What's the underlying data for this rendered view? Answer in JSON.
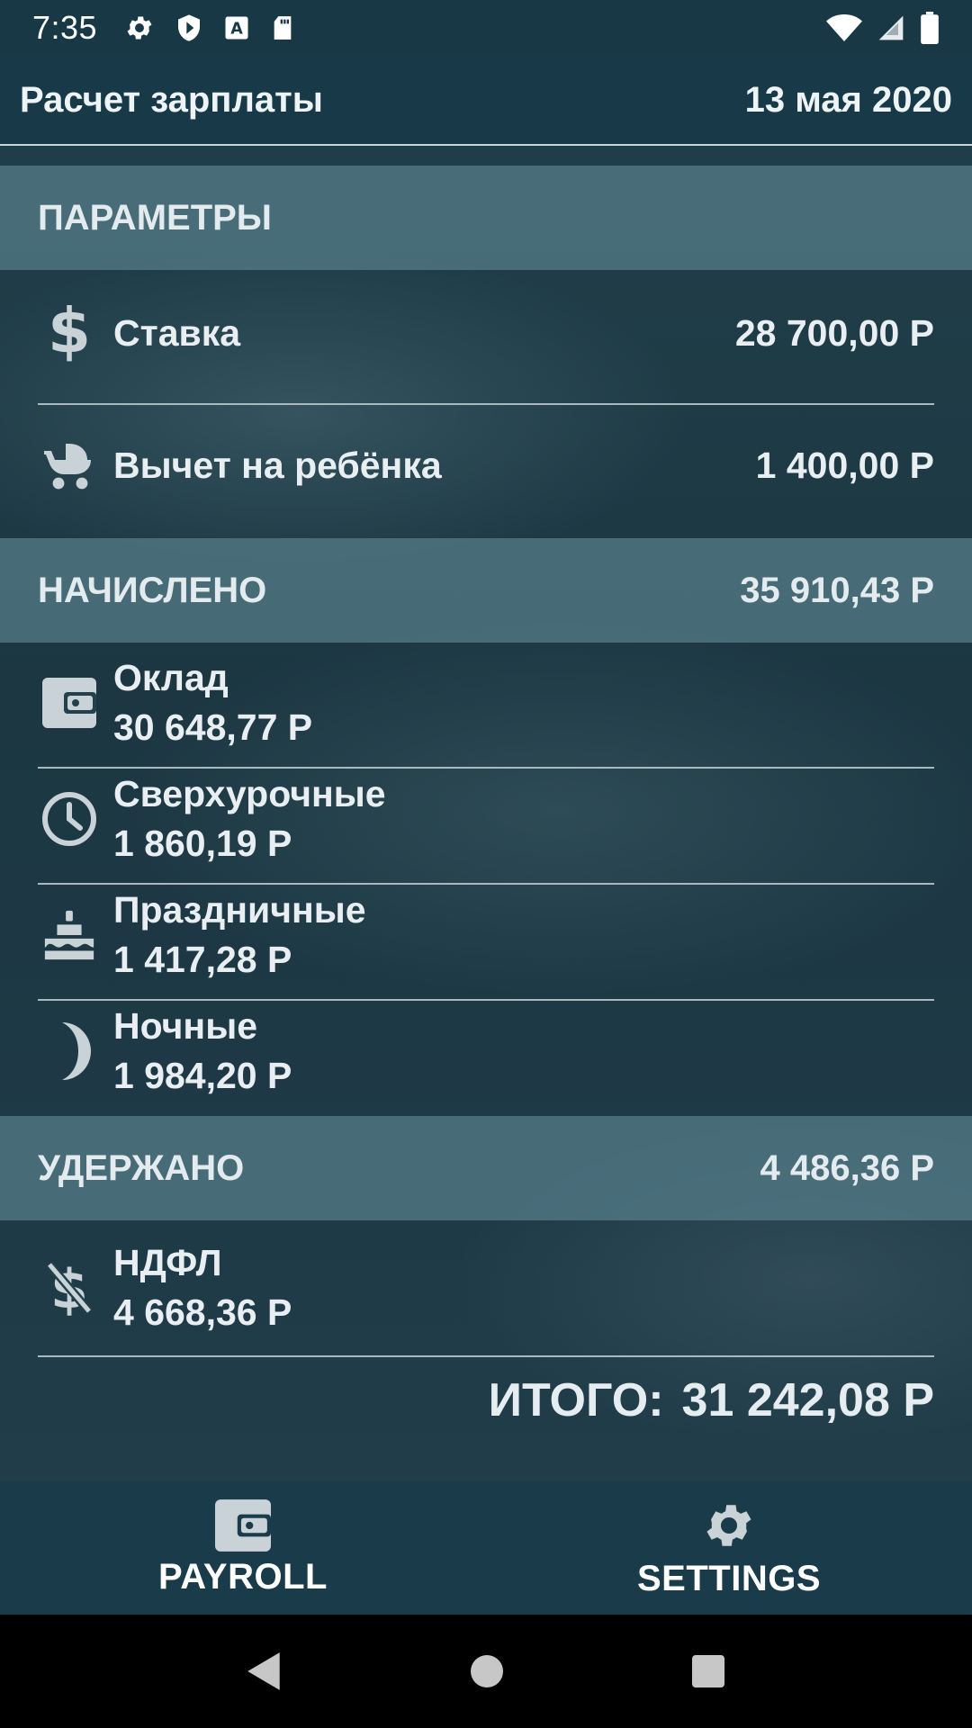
{
  "status_bar": {
    "time": "7:35",
    "icons": [
      "gear-icon",
      "shield-icon",
      "a-icon",
      "sd-card-icon"
    ],
    "right_icons": [
      "wifi-icon",
      "signal-icon",
      "battery-icon"
    ]
  },
  "app_bar": {
    "title": "Расчет зарплаты",
    "date": "13 мая 2020"
  },
  "parameters": {
    "header": "ПАРАМЕТРЫ",
    "items": [
      {
        "icon": "dollar-icon",
        "label": "Ставка",
        "value": "28 700,00 Р"
      },
      {
        "icon": "stroller-icon",
        "label": "Вычет на ребёнка",
        "value": "1 400,00 Р"
      }
    ]
  },
  "accrued": {
    "header": "НАЧИСЛЕНО",
    "total": "35 910,43 Р",
    "items": [
      {
        "icon": "wallet-icon",
        "label": "Оклад",
        "value": "30 648,77 Р"
      },
      {
        "icon": "clock-icon",
        "label": "Сверхурочные",
        "value": "1 860,19 Р"
      },
      {
        "icon": "cake-icon",
        "label": "Праздничные",
        "value": "1 417,28 Р"
      },
      {
        "icon": "moon-icon",
        "label": "Ночные",
        "value": "1 984,20 Р"
      }
    ]
  },
  "withheld": {
    "header": "УДЕРЖАНО",
    "total": "4 486,36 Р",
    "items": [
      {
        "icon": "no-money-icon",
        "label": "НДФЛ",
        "value": "4 668,36 Р"
      }
    ]
  },
  "summary": {
    "label": "ИТОГО:",
    "value": "31 242,08 Р"
  },
  "bottom_nav": {
    "items": [
      {
        "icon": "wallet-icon",
        "label": "PAYROLL"
      },
      {
        "icon": "gear-icon",
        "label": "SETTINGS"
      }
    ]
  },
  "system_nav": [
    "back-icon",
    "home-icon",
    "recents-icon"
  ],
  "colors": {
    "app_bar": "#183a48",
    "section_header": "#57808c",
    "text": "#e8eef1"
  }
}
